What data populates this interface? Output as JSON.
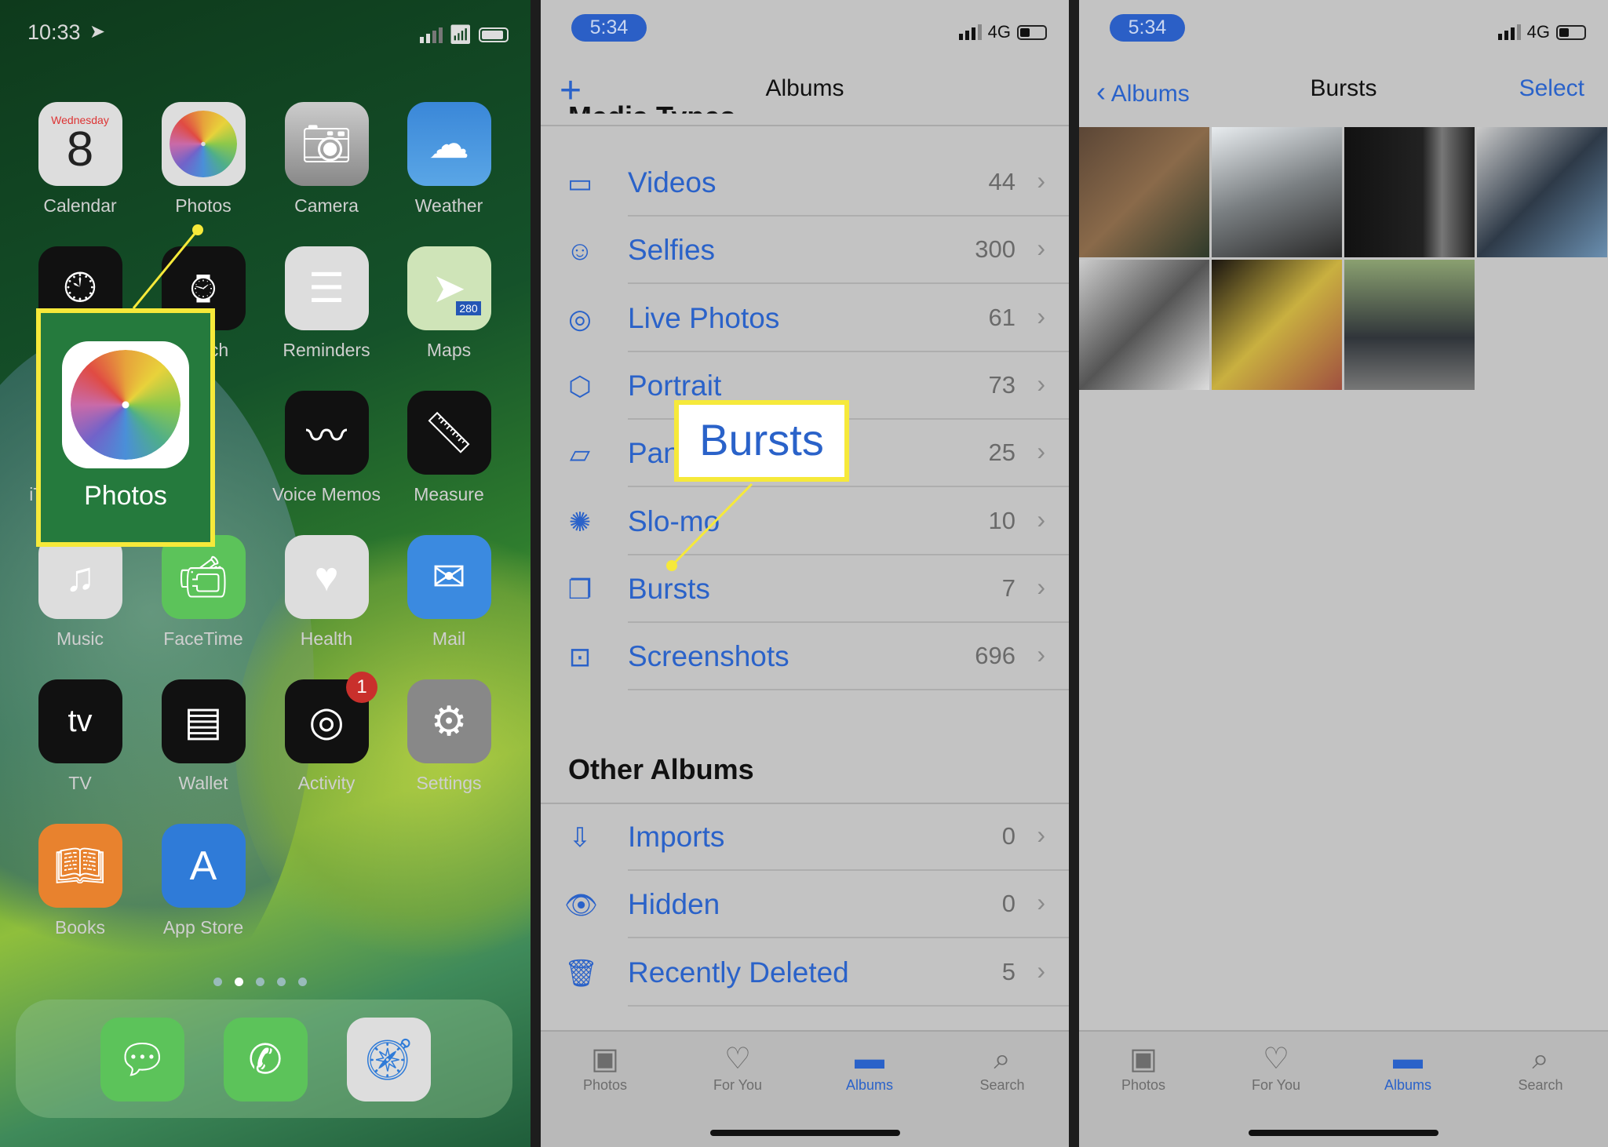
{
  "home": {
    "time": "10:33",
    "calendar_day": "Wednesday",
    "calendar_date": "8",
    "apps": [
      {
        "label": "Calendar",
        "icon": "calendar-icon"
      },
      {
        "label": "Photos",
        "icon": "photos-icon"
      },
      {
        "label": "Camera",
        "icon": "camera-icon"
      },
      {
        "label": "Weather",
        "icon": "weather-icon"
      },
      {
        "label": "Clock",
        "icon": "clock-icon"
      },
      {
        "label": "Watch",
        "icon": "watch-icon"
      },
      {
        "label": "Reminders",
        "icon": "reminders-icon"
      },
      {
        "label": "Maps",
        "icon": "maps-icon"
      },
      {
        "label": "iTunes Store",
        "icon": "itunes-icon"
      },
      {
        "label": "",
        "icon": ""
      },
      {
        "label": "Voice Memos",
        "icon": "voice-memos-icon"
      },
      {
        "label": "Measure",
        "icon": "measure-icon"
      },
      {
        "label": "Music",
        "icon": "music-icon"
      },
      {
        "label": "FaceTime",
        "icon": "facetime-icon"
      },
      {
        "label": "Health",
        "icon": "health-icon"
      },
      {
        "label": "Mail",
        "icon": "mail-icon"
      },
      {
        "label": "TV",
        "icon": "tv-icon"
      },
      {
        "label": "Wallet",
        "icon": "wallet-icon"
      },
      {
        "label": "Activity",
        "icon": "activity-icon"
      },
      {
        "label": "Settings",
        "icon": "settings-icon"
      },
      {
        "label": "Books",
        "icon": "books-icon"
      },
      {
        "label": "App Store",
        "icon": "app-store-icon"
      }
    ],
    "activity_badge": "1",
    "highlight_label": "Photos",
    "maps_shield": "280",
    "tv_text": "tv"
  },
  "albums": {
    "time": "5:34",
    "network": "4G",
    "title": "Albums",
    "section_partial": "Media Types",
    "media_types": [
      {
        "label": "Videos",
        "count": "44",
        "icon": "video-icon"
      },
      {
        "label": "Selfies",
        "count": "300",
        "icon": "selfie-icon"
      },
      {
        "label": "Live Photos",
        "count": "61",
        "icon": "live-photo-icon"
      },
      {
        "label": "Portrait",
        "count": "73",
        "icon": "portrait-cube-icon"
      },
      {
        "label": "Panoramas",
        "count": "25",
        "icon": "panorama-icon"
      },
      {
        "label": "Slo-mo",
        "count": "10",
        "icon": "slomo-icon"
      },
      {
        "label": "Bursts",
        "count": "7",
        "icon": "bursts-icon"
      },
      {
        "label": "Screenshots",
        "count": "696",
        "icon": "screenshot-icon"
      }
    ],
    "other_title": "Other Albums",
    "other": [
      {
        "label": "Imports",
        "count": "0",
        "icon": "import-icon"
      },
      {
        "label": "Hidden",
        "count": "0",
        "icon": "hidden-eye-icon"
      },
      {
        "label": "Recently Deleted",
        "count": "5",
        "icon": "trash-icon"
      }
    ],
    "callout": "Bursts"
  },
  "bursts": {
    "time": "5:34",
    "network": "4G",
    "back": "Albums",
    "title": "Bursts",
    "select": "Select",
    "photo_count": 7
  },
  "tabs": [
    {
      "label": "Photos"
    },
    {
      "label": "For You"
    },
    {
      "label": "Albums",
      "active": true
    },
    {
      "label": "Search"
    }
  ],
  "colors": {
    "accent": "#2a62c9",
    "highlight": "#f6e93a"
  }
}
